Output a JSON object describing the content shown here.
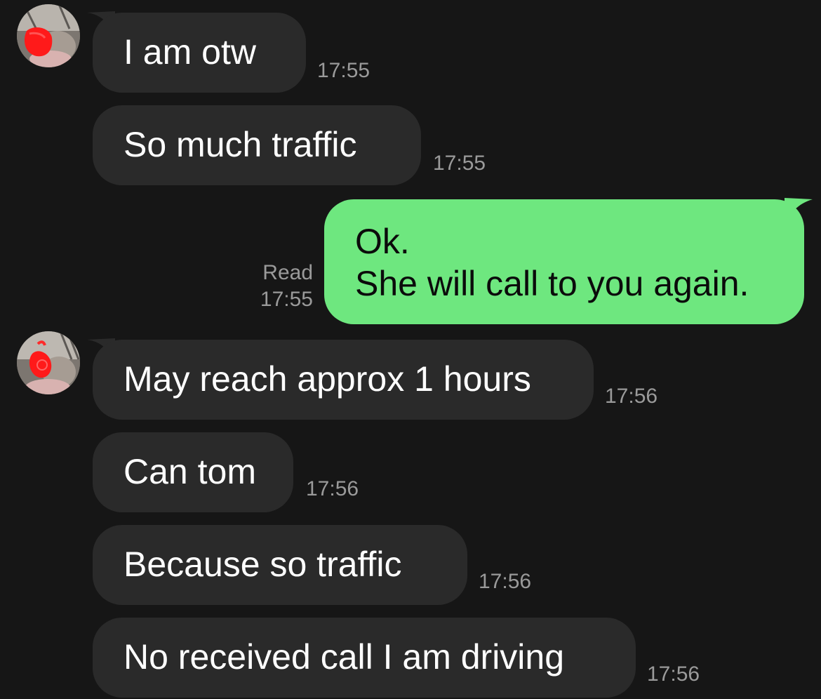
{
  "colors": {
    "background": "#161616",
    "incoming_bubble": "#2a2a2a",
    "outgoing_bubble": "#6ee77f",
    "timestamp": "#9a9a9a"
  },
  "messages": [
    {
      "direction": "incoming",
      "text": "I am otw",
      "time": "17:55",
      "show_avatar": true
    },
    {
      "direction": "incoming",
      "text": "So much traffic",
      "time": "17:55",
      "show_avatar": false
    },
    {
      "direction": "outgoing",
      "lines": [
        "Ok.",
        "She will call to you again."
      ],
      "status": "Read",
      "time": "17:55"
    },
    {
      "direction": "incoming",
      "text": "May reach approx 1 hours",
      "time": "17:56",
      "show_avatar": true
    },
    {
      "direction": "incoming",
      "text": "Can tom",
      "time": "17:56",
      "show_avatar": false
    },
    {
      "direction": "incoming",
      "text": "Because so traffic",
      "time": "17:56",
      "show_avatar": false
    },
    {
      "direction": "incoming",
      "text": "No received call I am driving",
      "time": "17:56",
      "show_avatar": false
    }
  ],
  "icons": {
    "avatar": "contact-avatar-icon"
  }
}
